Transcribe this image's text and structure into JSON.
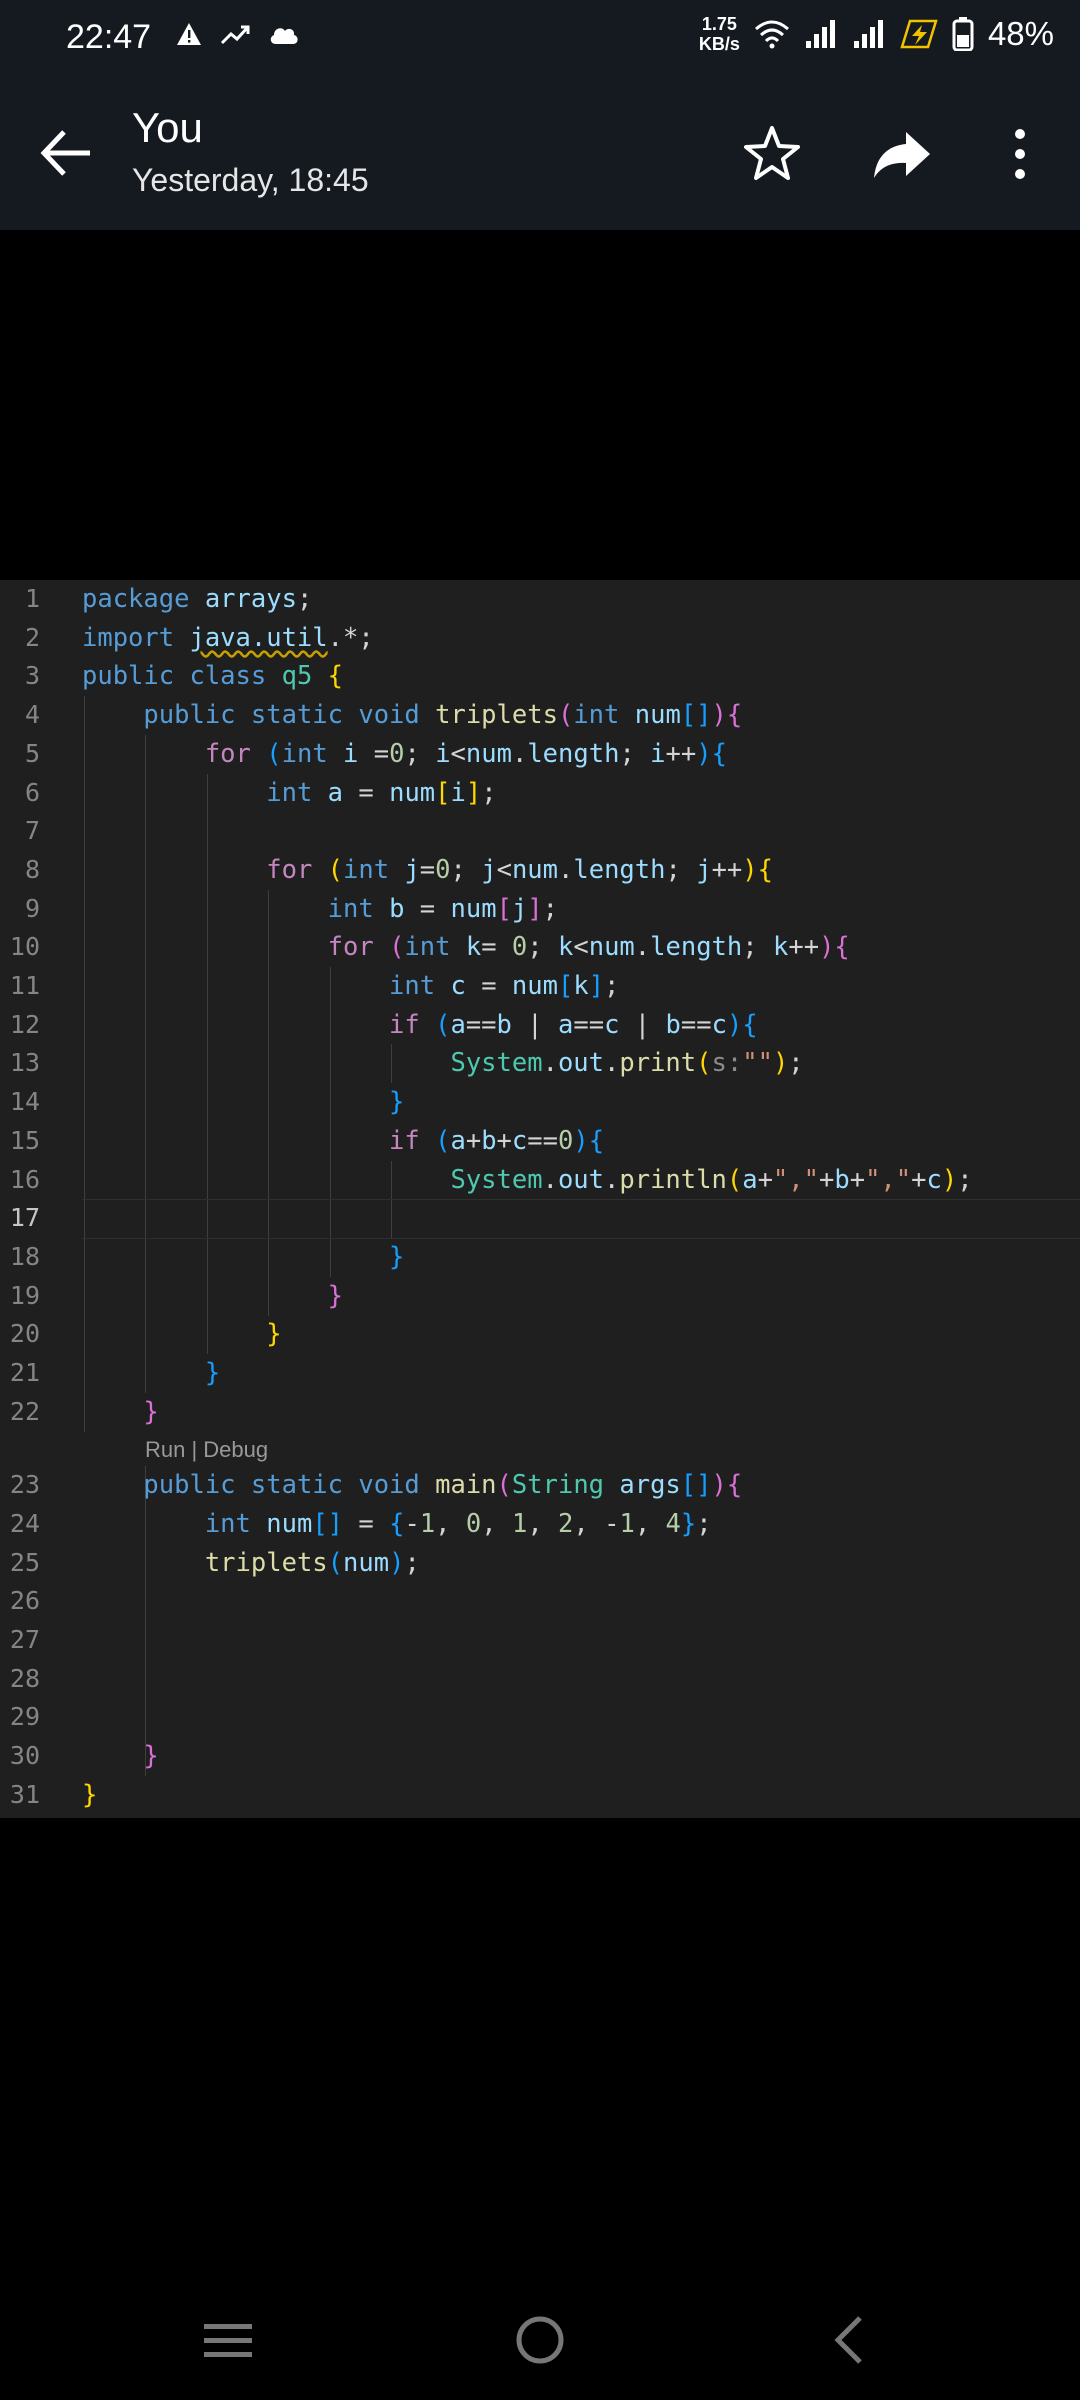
{
  "status_bar": {
    "time": "22:47",
    "speed_value": "1.75",
    "speed_unit": "KB/s",
    "battery": "48%"
  },
  "header": {
    "title": "You",
    "subtitle": "Yesterday, 18:45"
  },
  "code": {
    "codelens": "Run | Debug",
    "line_numbers": [
      "1",
      "2",
      "3",
      "4",
      "5",
      "6",
      "7",
      "8",
      "9",
      "10",
      "11",
      "12",
      "13",
      "14",
      "15",
      "16",
      "17",
      "18",
      "19",
      "20",
      "21",
      "22",
      "23",
      "24",
      "25",
      "26",
      "27",
      "28",
      "29",
      "30",
      "31"
    ],
    "lines": [
      [
        [
          "kw",
          "package "
        ],
        [
          "var",
          "arrays"
        ],
        [
          "pl",
          ";"
        ]
      ],
      [
        [
          "kw",
          "import "
        ],
        [
          "squig",
          "java.util"
        ],
        [
          "pl",
          ".*;"
        ]
      ],
      [
        [
          "kw",
          "public class "
        ],
        [
          "ty",
          "q5 "
        ],
        [
          "b1",
          "{"
        ]
      ],
      [
        [
          "pl",
          "    "
        ],
        [
          "kw",
          "public static void "
        ],
        [
          "fn",
          "triplets"
        ],
        [
          "b2",
          "("
        ],
        [
          "kw",
          "int "
        ],
        [
          "var",
          "num"
        ],
        [
          "b3",
          "[]"
        ],
        [
          "b2",
          ")"
        ],
        [
          "b2",
          "{"
        ]
      ],
      [
        [
          "pl",
          "        "
        ],
        [
          "ctl",
          "for "
        ],
        [
          "b3",
          "("
        ],
        [
          "kw",
          "int "
        ],
        [
          "var",
          "i "
        ],
        [
          "pl",
          "="
        ],
        [
          "num",
          "0"
        ],
        [
          "pl",
          "; "
        ],
        [
          "var",
          "i"
        ],
        [
          "pl",
          "<"
        ],
        [
          "var",
          "num"
        ],
        [
          "pl",
          "."
        ],
        [
          "var",
          "length"
        ],
        [
          "pl",
          "; "
        ],
        [
          "var",
          "i"
        ],
        [
          "pl",
          "++"
        ],
        [
          "b3",
          ")"
        ],
        [
          "b3",
          "{"
        ]
      ],
      [
        [
          "pl",
          "            "
        ],
        [
          "kw",
          "int "
        ],
        [
          "var",
          "a "
        ],
        [
          "pl",
          "= "
        ],
        [
          "var",
          "num"
        ],
        [
          "b1",
          "["
        ],
        [
          "var",
          "i"
        ],
        [
          "b1",
          "]"
        ],
        [
          "pl",
          ";"
        ]
      ],
      [],
      [
        [
          "pl",
          "            "
        ],
        [
          "ctl",
          "for "
        ],
        [
          "b1",
          "("
        ],
        [
          "kw",
          "int "
        ],
        [
          "var",
          "j"
        ],
        [
          "pl",
          "="
        ],
        [
          "num",
          "0"
        ],
        [
          "pl",
          "; "
        ],
        [
          "var",
          "j"
        ],
        [
          "pl",
          "<"
        ],
        [
          "var",
          "num"
        ],
        [
          "pl",
          "."
        ],
        [
          "var",
          "length"
        ],
        [
          "pl",
          "; "
        ],
        [
          "var",
          "j"
        ],
        [
          "pl",
          "++"
        ],
        [
          "b1",
          ")"
        ],
        [
          "b1",
          "{"
        ]
      ],
      [
        [
          "pl",
          "                "
        ],
        [
          "kw",
          "int "
        ],
        [
          "var",
          "b "
        ],
        [
          "pl",
          "= "
        ],
        [
          "var",
          "num"
        ],
        [
          "b2",
          "["
        ],
        [
          "var",
          "j"
        ],
        [
          "b2",
          "]"
        ],
        [
          "pl",
          ";"
        ]
      ],
      [
        [
          "pl",
          "                "
        ],
        [
          "ctl",
          "for "
        ],
        [
          "b2",
          "("
        ],
        [
          "kw",
          "int "
        ],
        [
          "var",
          "k"
        ],
        [
          "pl",
          "= "
        ],
        [
          "num",
          "0"
        ],
        [
          "pl",
          "; "
        ],
        [
          "var",
          "k"
        ],
        [
          "pl",
          "<"
        ],
        [
          "var",
          "num"
        ],
        [
          "pl",
          "."
        ],
        [
          "var",
          "length"
        ],
        [
          "pl",
          "; "
        ],
        [
          "var",
          "k"
        ],
        [
          "pl",
          "++"
        ],
        [
          "b2",
          ")"
        ],
        [
          "b2",
          "{"
        ]
      ],
      [
        [
          "pl",
          "                    "
        ],
        [
          "kw",
          "int "
        ],
        [
          "var",
          "c "
        ],
        [
          "pl",
          "= "
        ],
        [
          "var",
          "num"
        ],
        [
          "b3",
          "["
        ],
        [
          "var",
          "k"
        ],
        [
          "b3",
          "]"
        ],
        [
          "pl",
          ";"
        ]
      ],
      [
        [
          "pl",
          "                    "
        ],
        [
          "ctl",
          "if "
        ],
        [
          "b3",
          "("
        ],
        [
          "var",
          "a"
        ],
        [
          "pl",
          "=="
        ],
        [
          "var",
          "b "
        ],
        [
          "pl",
          "| "
        ],
        [
          "var",
          "a"
        ],
        [
          "pl",
          "=="
        ],
        [
          "var",
          "c "
        ],
        [
          "pl",
          "| "
        ],
        [
          "var",
          "b"
        ],
        [
          "pl",
          "=="
        ],
        [
          "var",
          "c"
        ],
        [
          "b3",
          ")"
        ],
        [
          "b3",
          "{"
        ]
      ],
      [
        [
          "pl",
          "                        "
        ],
        [
          "ty",
          "System"
        ],
        [
          "pl",
          "."
        ],
        [
          "var",
          "out"
        ],
        [
          "pl",
          "."
        ],
        [
          "fn",
          "print"
        ],
        [
          "b1",
          "("
        ],
        [
          "hint",
          "s:"
        ],
        [
          "str",
          "\"\""
        ],
        [
          "b1",
          ")"
        ],
        [
          "pl",
          ";"
        ]
      ],
      [
        [
          "pl",
          "                    "
        ],
        [
          "b3",
          "}"
        ]
      ],
      [
        [
          "pl",
          "                    "
        ],
        [
          "ctl",
          "if "
        ],
        [
          "b3",
          "("
        ],
        [
          "var",
          "a"
        ],
        [
          "pl",
          "+"
        ],
        [
          "var",
          "b"
        ],
        [
          "pl",
          "+"
        ],
        [
          "var",
          "c"
        ],
        [
          "pl",
          "=="
        ],
        [
          "num",
          "0"
        ],
        [
          "b3",
          ")"
        ],
        [
          "b3",
          "{"
        ]
      ],
      [
        [
          "pl",
          "                        "
        ],
        [
          "ty",
          "System"
        ],
        [
          "pl",
          "."
        ],
        [
          "var",
          "out"
        ],
        [
          "pl",
          "."
        ],
        [
          "fn",
          "println"
        ],
        [
          "b1",
          "("
        ],
        [
          "var",
          "a"
        ],
        [
          "pl",
          "+"
        ],
        [
          "str",
          "\",\""
        ],
        [
          "pl",
          "+"
        ],
        [
          "var",
          "b"
        ],
        [
          "pl",
          "+"
        ],
        [
          "str",
          "\",\""
        ],
        [
          "pl",
          "+"
        ],
        [
          "var",
          "c"
        ],
        [
          "b1",
          ")"
        ],
        [
          "pl",
          ";"
        ]
      ],
      [],
      [
        [
          "pl",
          "                    "
        ],
        [
          "b3",
          "}"
        ]
      ],
      [
        [
          "pl",
          "                "
        ],
        [
          "b2",
          "}"
        ]
      ],
      [
        [
          "pl",
          "            "
        ],
        [
          "b1",
          "}"
        ]
      ],
      [
        [
          "pl",
          "        "
        ],
        [
          "b3",
          "}"
        ]
      ],
      [
        [
          "pl",
          "    "
        ],
        [
          "b2",
          "}"
        ]
      ],
      [
        [
          "pl",
          "    "
        ],
        [
          "kw",
          "public static void "
        ],
        [
          "fn",
          "main"
        ],
        [
          "b2",
          "("
        ],
        [
          "ty",
          "String "
        ],
        [
          "var",
          "args"
        ],
        [
          "b3",
          "[]"
        ],
        [
          "b2",
          ")"
        ],
        [
          "b2",
          "{"
        ]
      ],
      [
        [
          "pl",
          "        "
        ],
        [
          "kw",
          "int "
        ],
        [
          "var",
          "num"
        ],
        [
          "b3",
          "[] "
        ],
        [
          "pl",
          "= "
        ],
        [
          "b3",
          "{"
        ],
        [
          "pl",
          "-"
        ],
        [
          "num",
          "1"
        ],
        [
          "pl",
          ", "
        ],
        [
          "num",
          "0"
        ],
        [
          "pl",
          ", "
        ],
        [
          "num",
          "1"
        ],
        [
          "pl",
          ", "
        ],
        [
          "num",
          "2"
        ],
        [
          "pl",
          ", -"
        ],
        [
          "num",
          "1"
        ],
        [
          "pl",
          ", "
        ],
        [
          "num",
          "4"
        ],
        [
          "b3",
          "}"
        ],
        [
          "pl",
          ";"
        ]
      ],
      [
        [
          "pl",
          "        "
        ],
        [
          "fn",
          "triplets"
        ],
        [
          "b3",
          "("
        ],
        [
          "var",
          "num"
        ],
        [
          "b3",
          ")"
        ],
        [
          "pl",
          ";"
        ]
      ],
      [],
      [],
      [],
      [],
      [
        [
          "pl",
          "    "
        ],
        [
          "b2",
          "}"
        ]
      ],
      [
        [
          "b1",
          "}"
        ]
      ]
    ]
  }
}
